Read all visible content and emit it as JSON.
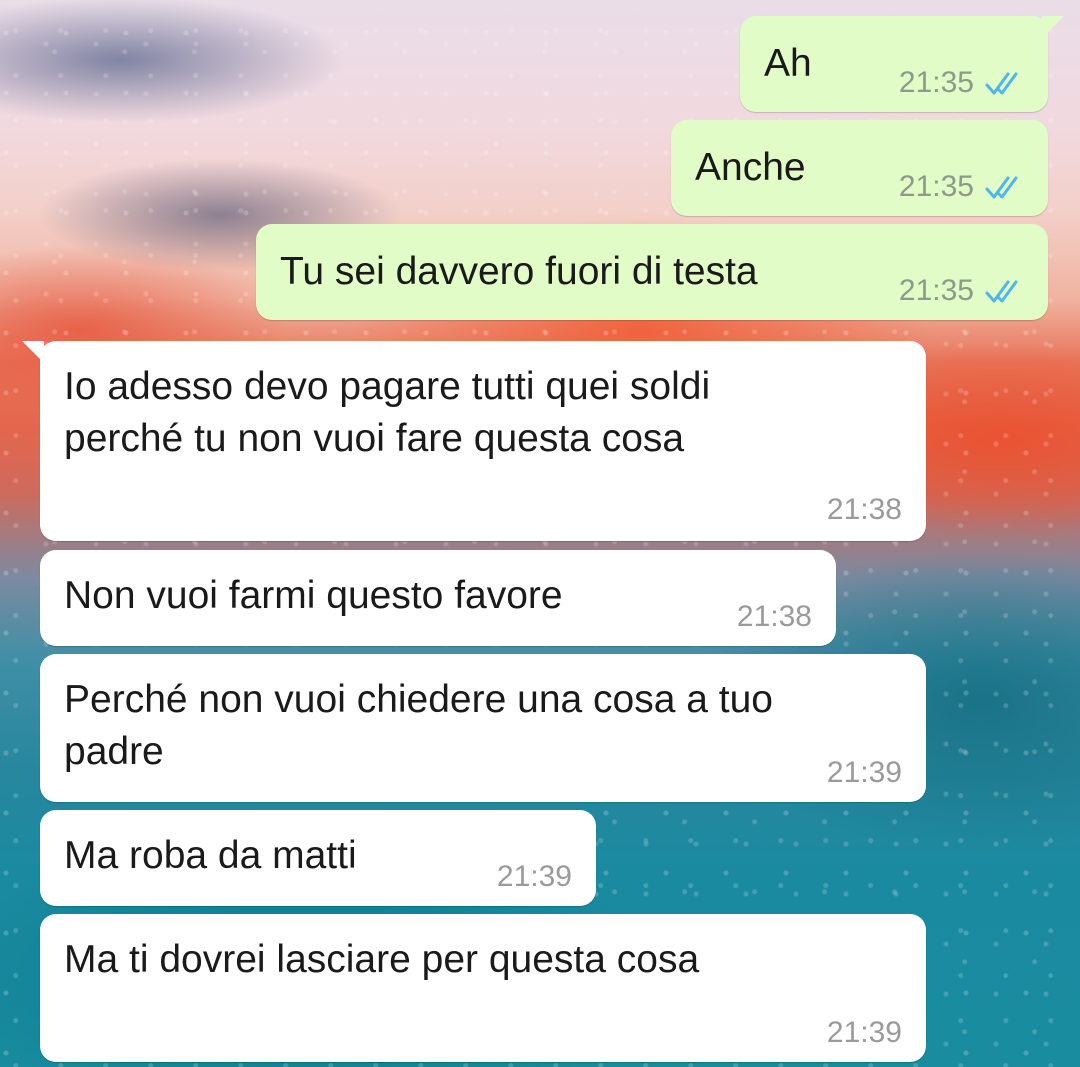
{
  "chat": {
    "messages": [
      {
        "direction": "outgoing",
        "text": "Ah",
        "time": "21:35",
        "status_icon": "double-check-read-icon"
      },
      {
        "direction": "outgoing",
        "text": "Anche",
        "time": "21:35",
        "status_icon": "double-check-read-icon"
      },
      {
        "direction": "outgoing",
        "text": "Tu sei davvero fuori di testa",
        "time": "21:35",
        "status_icon": "double-check-read-icon"
      },
      {
        "direction": "incoming",
        "text": "Io adesso devo pagare tutti quei soldi\nperché tu non vuoi fare questa cosa",
        "time": "21:38"
      },
      {
        "direction": "incoming",
        "text": "Non vuoi farmi questo favore",
        "time": "21:38"
      },
      {
        "direction": "incoming",
        "text": "Perché non vuoi chiedere una cosa a tuo\npadre",
        "time": "21:39"
      },
      {
        "direction": "incoming",
        "text": "Ma roba da matti",
        "time": "21:39"
      },
      {
        "direction": "incoming",
        "text": "Ma ti dovrei lasciare per questa cosa",
        "time": "21:39"
      }
    ]
  },
  "colors": {
    "outgoing_bubble": "#e1fcc6",
    "incoming_bubble": "#ffffff",
    "read_ticks": "#4fb6ec"
  }
}
